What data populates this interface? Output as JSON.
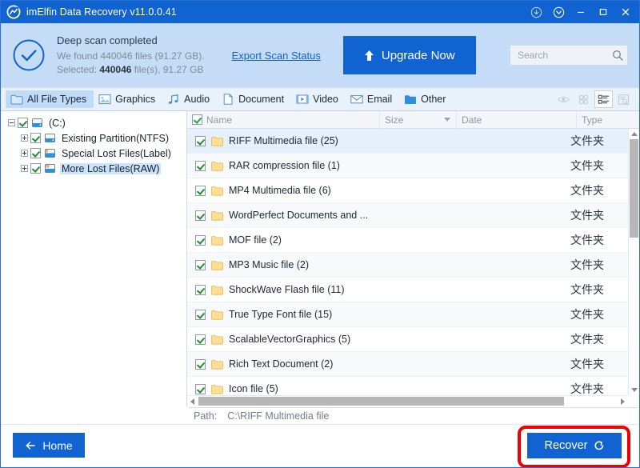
{
  "window": {
    "title": "imElfin Data Recovery v11.0.0.41",
    "app_icon": "recovery-circular-arrow-icon",
    "controls": [
      {
        "name": "download-circle-icon",
        "glyph": "download"
      },
      {
        "name": "chevron-down-circle-icon",
        "glyph": "chevron-down"
      },
      {
        "name": "minimize-button",
        "glyph": "minimize"
      },
      {
        "name": "maximize-button",
        "glyph": "maximize"
      },
      {
        "name": "close-button",
        "glyph": "close"
      }
    ],
    "accent_color": "#1263d2",
    "titlebar_color": "#1263d2",
    "banner_color": "#c5dcf7"
  },
  "banner": {
    "status_icon": "check-circle-icon",
    "title": "Deep scan completed",
    "found_text_prefix": "We found ",
    "found_count": "440046",
    "found_text_suffix": " files (91.27 GB).",
    "selected_label": "Selected: ",
    "selected_count": "440046",
    "selected_suffix": " file(s), 91.27 GB",
    "export_link": "Export Scan Status",
    "upgrade_button": "Upgrade Now"
  },
  "search": {
    "value": "",
    "placeholder": "Search",
    "icon": "search-icon"
  },
  "type_tabs": [
    {
      "label": "All File Types",
      "icon": "folder-icon",
      "active": true
    },
    {
      "label": "Graphics",
      "icon": "image-icon",
      "active": false
    },
    {
      "label": "Audio",
      "icon": "music-note-icon",
      "active": false
    },
    {
      "label": "Document",
      "icon": "document-icon",
      "active": false
    },
    {
      "label": "Video",
      "icon": "film-icon",
      "active": false
    },
    {
      "label": "Email",
      "icon": "envelope-icon",
      "active": false
    },
    {
      "label": "Other",
      "icon": "folder-open-icon",
      "active": false
    }
  ],
  "view_buttons": [
    {
      "name": "preview-eye-icon",
      "active": false
    },
    {
      "name": "grid-view-icon",
      "active": false
    },
    {
      "name": "detail-list-view-icon",
      "active": true
    },
    {
      "name": "search-in-results-icon",
      "active": false
    }
  ],
  "tree": [
    {
      "label": "(C:)",
      "indent": 1,
      "twisty": "minus",
      "checked": true,
      "selected": false,
      "icon": "drive-icon"
    },
    {
      "label": "Existing Partition(NTFS)",
      "indent": 2,
      "twisty": "plus",
      "checked": true,
      "selected": false,
      "icon": "drive-icon"
    },
    {
      "label": "Special Lost Files(Label)",
      "indent": 2,
      "twisty": "plus",
      "checked": true,
      "selected": false,
      "icon": "drive-label-icon"
    },
    {
      "label": "More Lost Files(RAW)",
      "indent": 2,
      "twisty": "plus",
      "checked": true,
      "selected": true,
      "icon": "drive-raw-icon"
    }
  ],
  "list": {
    "columns": [
      {
        "key": "name",
        "label": "Name",
        "has_checkbox": true,
        "sorted": false
      },
      {
        "key": "size",
        "label": "Size",
        "has_checkbox": false,
        "sorted": true
      },
      {
        "key": "date",
        "label": "Date",
        "has_checkbox": false,
        "sorted": false
      },
      {
        "key": "type",
        "label": "Type",
        "has_checkbox": false,
        "sorted": false
      }
    ],
    "rows": [
      {
        "name": "RIFF Multimedia file (25)",
        "size": "",
        "date": "",
        "type": "文件夹",
        "checked": true,
        "selected": true
      },
      {
        "name": "RAR compression file (1)",
        "size": "",
        "date": "",
        "type": "文件夹",
        "checked": true,
        "selected": false
      },
      {
        "name": "MP4 Multimedia file (6)",
        "size": "",
        "date": "",
        "type": "文件夹",
        "checked": true,
        "selected": false
      },
      {
        "name": "WordPerfect Documents and ...",
        "size": "",
        "date": "",
        "type": "文件夹",
        "checked": true,
        "selected": false
      },
      {
        "name": "MOF file (2)",
        "size": "",
        "date": "",
        "type": "文件夹",
        "checked": true,
        "selected": false
      },
      {
        "name": "MP3 Music file (2)",
        "size": "",
        "date": "",
        "type": "文件夹",
        "checked": true,
        "selected": false
      },
      {
        "name": "ShockWave Flash file (11)",
        "size": "",
        "date": "",
        "type": "文件夹",
        "checked": true,
        "selected": false
      },
      {
        "name": "True Type Font file (15)",
        "size": "",
        "date": "",
        "type": "文件夹",
        "checked": true,
        "selected": false
      },
      {
        "name": "ScalableVectorGraphics (5)",
        "size": "",
        "date": "",
        "type": "文件夹",
        "checked": true,
        "selected": false
      },
      {
        "name": "Rich Text Document (2)",
        "size": "",
        "date": "",
        "type": "文件夹",
        "checked": true,
        "selected": false
      },
      {
        "name": "Icon file (5)",
        "size": "",
        "date": "",
        "type": "文件夹",
        "checked": true,
        "selected": false
      }
    ]
  },
  "path_bar": {
    "label": "Path:",
    "value": "C:\\RIFF Multimedia file"
  },
  "footer": {
    "home_button": "Home",
    "home_icon": "arrow-left-icon",
    "recover_button": "Recover",
    "recover_icon": "refresh-arrow-icon",
    "annotation_color": "#ee0000"
  }
}
